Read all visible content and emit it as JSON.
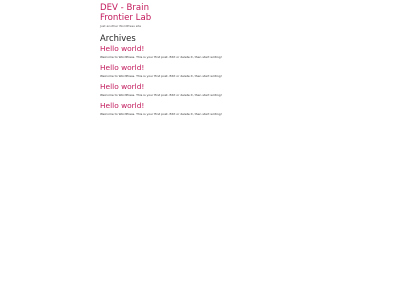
{
  "site": {
    "title": "DEV - Brain Frontier Lab",
    "tagline": "Just another WordPress site"
  },
  "archive": {
    "heading": "Archives"
  },
  "posts": [
    {
      "title": "Hello world!",
      "excerpt": "Welcome to WordPress. This is your first post. Edit or delete it, then start writing!"
    },
    {
      "title": "Hello world!",
      "excerpt": "Welcome to WordPress. This is your first post. Edit or delete it, then start writing!"
    },
    {
      "title": "Hello world!",
      "excerpt": "Welcome to WordPress. This is your first post. Edit or delete it, then start writing!"
    },
    {
      "title": "Hello world!",
      "excerpt": "Welcome to WordPress. This is your first post. Edit or delete it, then start writing!"
    }
  ],
  "colors": {
    "link": "#c2185b",
    "text": "#222222",
    "background": "#ffffff"
  }
}
